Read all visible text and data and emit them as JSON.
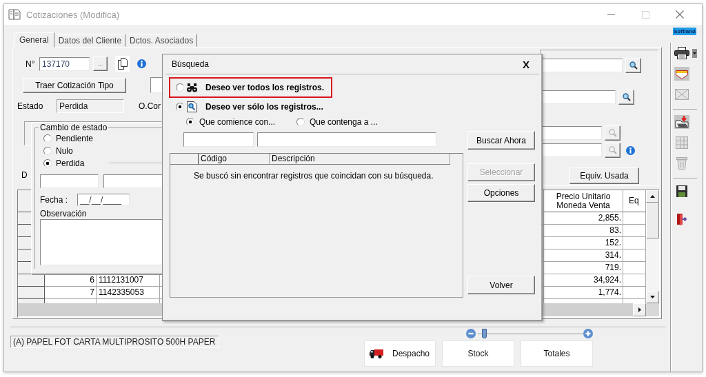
{
  "window": {
    "title": "Cotizaciones (Modifica)",
    "controls": [
      {
        "disabled": false
      },
      {
        "disabled": true
      },
      {
        "disabled": false
      }
    ]
  },
  "brand_badge": "Softland",
  "tabs": [
    {
      "label": "General",
      "selected": true
    },
    {
      "label": "Datos del Cliente",
      "selected": false
    },
    {
      "label": "Dctos. Asociados",
      "selected": false
    }
  ],
  "header_form": {
    "number": {
      "label": "N°",
      "value": "137170"
    },
    "browse_button": "...",
    "template_button": "Traer Cotización Tipo",
    "status": {
      "label": "Estado",
      "value": "Perdida"
    },
    "label_3": "O.Cor",
    "label_4": "D"
  },
  "lookup_fields": [
    {
      "search_disabled": false,
      "info": false
    },
    {
      "search_disabled": false,
      "info": false
    },
    {
      "search_disabled": true,
      "info": false
    },
    {
      "search_disabled": true,
      "info": true
    }
  ],
  "equivalence_button": "Equiv. Usada",
  "table": {
    "columns": [
      {
        "label": "Precio Unitario Moneda Venta"
      },
      {
        "label": "Eq"
      }
    ],
    "rows": [
      {
        "price": "2,855."
      },
      {
        "price": "83."
      },
      {
        "price": "152."
      },
      {
        "price": "314."
      },
      {
        "price": "719."
      },
      {
        "number": "6",
        "code": "1112131007",
        "price": "34,924."
      },
      {
        "number": "7",
        "code": "1142335053",
        "price": "1,774."
      }
    ]
  },
  "status_panel": {
    "title": "Cambio de estado",
    "options": [
      {
        "label": "Pendiente",
        "selected": false
      },
      {
        "label": "Nulo",
        "selected": false
      },
      {
        "label": "Perdida",
        "selected": true
      }
    ],
    "date": {
      "label": "Fecha :",
      "value": "__/__/____"
    },
    "notes": {
      "label": "Observación"
    }
  },
  "search_dialog": {
    "title": "Búsqueda",
    "close": "X",
    "options": [
      {
        "label": "Deseo ver todos los registros.",
        "selected": false,
        "highlighted": true
      },
      {
        "label": "Deseo ver sólo los registros...",
        "selected": true,
        "highlighted": false
      }
    ],
    "match_modes": [
      {
        "label": "Que comience con...",
        "selected": true
      },
      {
        "label": "Que contenga a ...",
        "selected": false
      }
    ],
    "results": {
      "columns": [
        "Código",
        "Descripción"
      ],
      "message": "Se buscó sin encontrar registros que coincidan con su búsqueda."
    },
    "buttons": [
      {
        "label": "Buscar Ahora",
        "disabled": false
      },
      {
        "label": "Seleccionar",
        "disabled": true
      },
      {
        "label": "Opciones",
        "disabled": false
      },
      {
        "label": "Volver",
        "disabled": false
      }
    ]
  },
  "description": "(A) PAPEL FOT CARTA MULTIPROSITO 500H PAPER",
  "zoom_slider": {
    "level": 0.04
  },
  "action_buttons": [
    {
      "label": "Despacho"
    },
    {
      "label": "Stock"
    },
    {
      "label": "Totales"
    }
  ],
  "toolbar": [
    {
      "buttons": [
        {
          "disabled": false
        },
        {
          "disabled": false
        },
        {
          "disabled": true
        }
      ]
    },
    {
      "buttons": [
        {
          "disabled": false
        },
        {
          "disabled": true
        },
        {
          "disabled": true
        }
      ]
    },
    {
      "buttons": [
        {
          "disabled": false
        },
        {
          "disabled": false
        }
      ]
    }
  ]
}
